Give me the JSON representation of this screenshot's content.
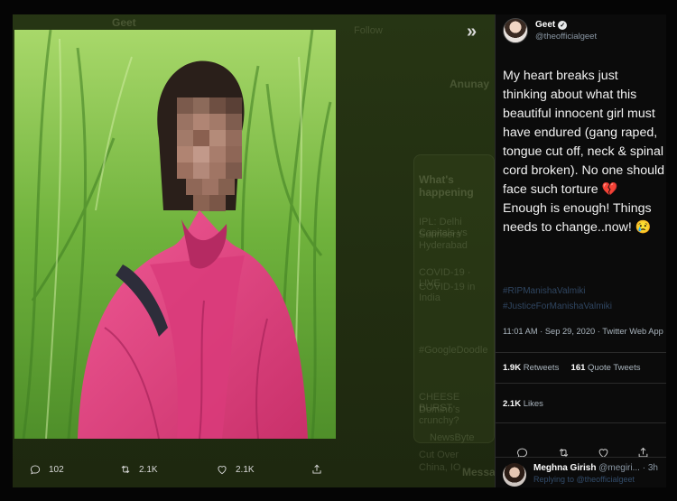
{
  "background": {
    "top_name": "Geet",
    "follow": "Follow",
    "reply_user": "Anunay",
    "trend_header": "What's happening",
    "trend1_sub": "IPL: Delhi Capitals vs",
    "trend1_sub2": "Sunrisers Hyderabad",
    "trend2_tag": "COVID-19 · LIVE",
    "trend2_title": "COVID-19 in India",
    "trend3": "#GoogleDoodle",
    "trend4": "CHEESE BURST",
    "trend4_sub": "Domino's crunchy?",
    "trend5": "NewsByte",
    "trend5_sub": "Cut Over",
    "trend5_sub2": "China, IO",
    "messages": "Messages"
  },
  "actions": {
    "replies": "102",
    "retweets": "2.1K",
    "likes": "2.1K"
  },
  "tweet": {
    "name": "Geet",
    "handle": "@theofficialgeet",
    "text_part1": "My heart breaks just thinking about what this beautiful innocent girl must have endured (gang raped, tongue cut off, neck & spinal cord broken). No one should face such torture ",
    "heart_emoji": "💔",
    "text_part2": " Enough is enough! Things needs to change..now! ",
    "sad_emoji": "😢",
    "hashtag1": "#RIPManishaValmiki",
    "hashtag2": "#JusticeForManishaValmiki",
    "timestamp": "11:01 AM · Sep 29, 2020 · Twitter Web App",
    "retweets_count": "1.9K",
    "retweets_label": "Retweets",
    "quotes_count": "161",
    "quotes_label": "Quote Tweets",
    "likes_count": "2.1K",
    "likes_label": "Likes"
  },
  "reply": {
    "name": "Meghna Girish",
    "handle": "@megiri... · 3h",
    "sub": "Replying to @theofficialgeet"
  },
  "colors": {
    "panel_bg": "#0b0b0b",
    "heart": "#e0245e",
    "pink_scarf": "#e0447f",
    "grass": "#7fbf4a"
  }
}
